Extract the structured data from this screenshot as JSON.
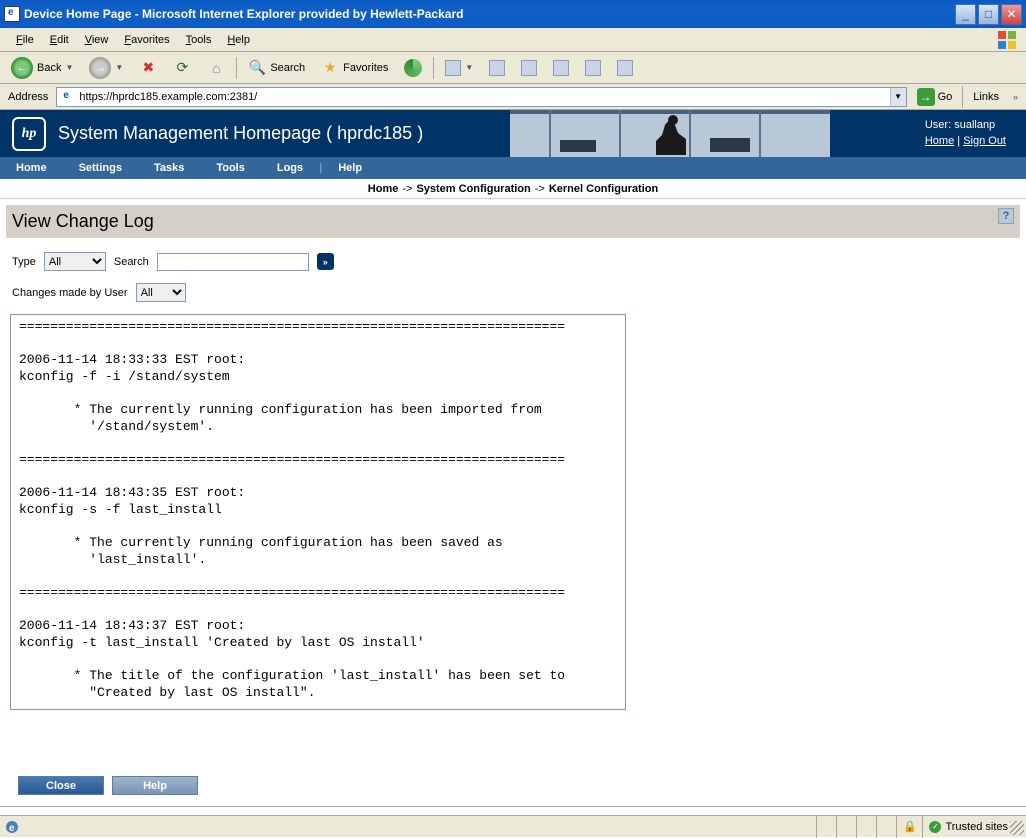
{
  "window": {
    "title": "Device Home Page - Microsoft Internet Explorer provided by Hewlett-Packard"
  },
  "menubar": [
    "File",
    "Edit",
    "View",
    "Favorites",
    "Tools",
    "Help"
  ],
  "toolbar": {
    "back": "Back",
    "search": "Search",
    "favorites": "Favorites"
  },
  "addressbar": {
    "label": "Address",
    "url": "https://hprdc185.example.com:2381/",
    "go": "Go",
    "links": "Links"
  },
  "smh": {
    "title": "System Management Homepage ( hprdc185 )",
    "logo": "hp",
    "user_label": "User:",
    "user": "suallanp",
    "home_link": "Home",
    "signout_link": "Sign Out",
    "nav": [
      "Home",
      "Settings",
      "Tasks",
      "Tools",
      "Logs",
      "|",
      "Help"
    ],
    "breadcrumb": [
      "Home",
      "System Configuration",
      "Kernel Configuration"
    ]
  },
  "page": {
    "title": "View Change Log",
    "type_label": "Type",
    "type_value": "All",
    "search_label": "Search",
    "search_value": "",
    "user_label": "Changes made by User",
    "user_value": "All",
    "close": "Close",
    "help": "Help",
    "log": "======================================================================\n\n2006-11-14 18:33:33 EST root:\nkconfig -f -i /stand/system\n\n       * The currently running configuration has been imported from\n         '/stand/system'.\n\n======================================================================\n\n2006-11-14 18:43:35 EST root:\nkconfig -s -f last_install\n\n       * The currently running configuration has been saved as\n         'last_install'.\n\n======================================================================\n\n2006-11-14 18:43:37 EST root:\nkconfig -t last_install 'Created by last OS install'\n\n       * The title of the configuration 'last_install' has been set to\n         \"Created by last OS install\".\n\n======================================================================"
  },
  "statusbar": {
    "zone": "Trusted sites"
  }
}
